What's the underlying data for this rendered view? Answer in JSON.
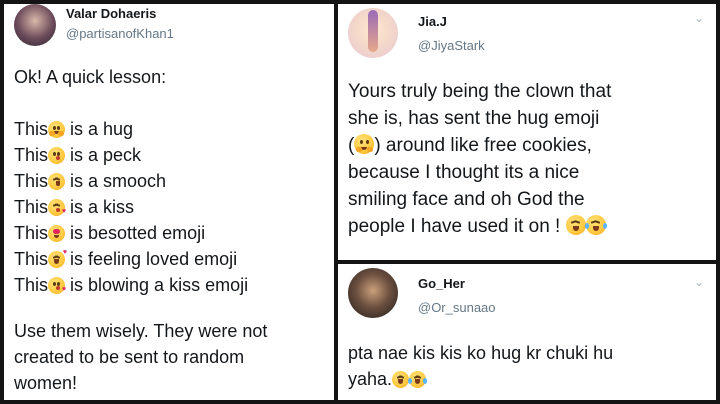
{
  "tweet_left": {
    "name": "Valar Dohaeris",
    "handle": "@partisanofKhan1",
    "intro": "Ok! A quick lesson:",
    "lessons": [
      {
        "prefix": "This",
        "emoji": "hugging-face",
        "meaning": " is a hug"
      },
      {
        "prefix": "This",
        "emoji": "kissing-face",
        "meaning": " is a peck"
      },
      {
        "prefix": "This",
        "emoji": "kissing-smiling-eyes",
        "meaning": " is a smooch"
      },
      {
        "prefix": "This",
        "emoji": "kissing-closed-eyes",
        "meaning": " is a kiss"
      },
      {
        "prefix": "This",
        "emoji": "heart-eyes",
        "meaning": " is besotted emoji"
      },
      {
        "prefix": "This",
        "emoji": "smiling-face-with-hearts",
        "meaning": " is feeling loved emoji"
      },
      {
        "prefix": "This",
        "emoji": "face-blowing-kiss",
        "meaning": " is blowing a kiss emoji"
      }
    ],
    "closing_lines": [
      "Use them wisely. They were not",
      "created to be sent to random",
      "women!"
    ]
  },
  "tweet_top_right": {
    "name": "Jia.J",
    "handle": "@JiyaStark",
    "lines": [
      "Yours truly being the clown that",
      "she is,  has sent the hug emoji",
      "(",
      ") around like free cookies,",
      "because I thought its a nice",
      "smiling face and oh God the",
      "people I have used it on !"
    ],
    "inline_emoji": "hugging-face",
    "trailing_emojis": [
      "grinning-squinting-face",
      "face-with-tears-of-joy"
    ]
  },
  "tweet_bottom_right": {
    "name": "Go_Her",
    "handle": "@Or_sunaao",
    "lines": [
      "pta nae kis kis ko hug kr chuki hu",
      "yaha."
    ],
    "trailing_emojis": [
      "grinning-squinting-face",
      "face-with-tears-of-joy"
    ]
  },
  "chevron_glyph": "⌄",
  "colors": {
    "text": "#14171a",
    "handle": "#657786",
    "divider": "#141414"
  }
}
